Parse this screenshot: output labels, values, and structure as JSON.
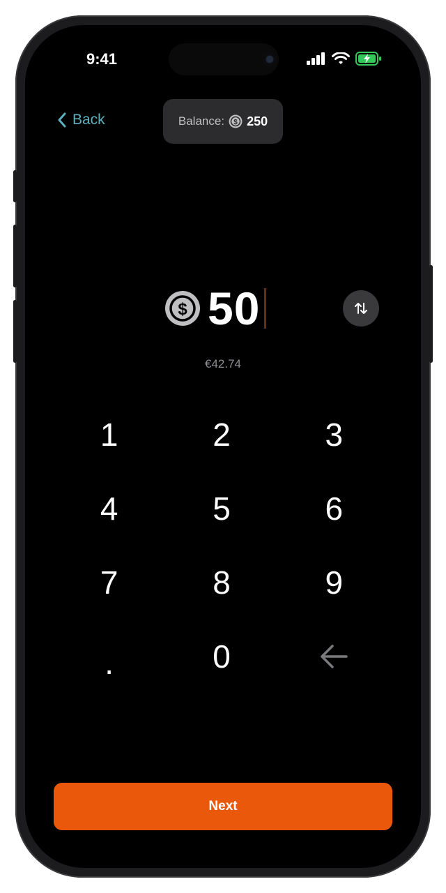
{
  "status_bar": {
    "time": "9:41",
    "icons": [
      "cellular-signal-icon",
      "wifi-icon",
      "battery-charging-icon"
    ],
    "battery_color": "#34c759"
  },
  "nav": {
    "back_label": "Back"
  },
  "balance": {
    "label": "Balance:",
    "value": "250",
    "icon": "usdc-coin-icon"
  },
  "amount": {
    "value": "50",
    "icon": "usdc-coin-icon",
    "fiat_equivalent": "€42.74"
  },
  "swap_button": {
    "icon": "swap-vertical-icon"
  },
  "keypad": {
    "keys": [
      "1",
      "2",
      "3",
      "4",
      "5",
      "6",
      "7",
      "8",
      "9",
      ".",
      "0"
    ],
    "backspace_icon": "backspace-arrow-icon"
  },
  "next_button": {
    "label": "Next",
    "color": "#ea580c"
  },
  "colors": {
    "accent": "#ea580c",
    "back_link": "#5fb0bf",
    "background": "#000000"
  }
}
